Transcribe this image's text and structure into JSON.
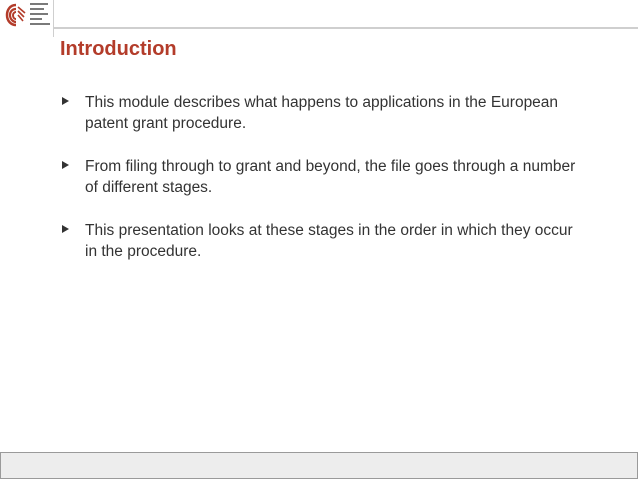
{
  "slide": {
    "title": "Introduction",
    "bullets": [
      "This module describes what happens to applications in the European patent grant procedure.",
      "From filing through to grant and beyond, the file goes through a number of different stages.",
      "This presentation looks at these stages in the order in which they occur in the procedure."
    ]
  },
  "colors": {
    "title": "#b33c2a",
    "logo": "#b33c2a",
    "text": "#333333"
  },
  "icons": {
    "logo": "epo-spiral-logo-icon",
    "bullet": "triangle-bullet-icon"
  }
}
